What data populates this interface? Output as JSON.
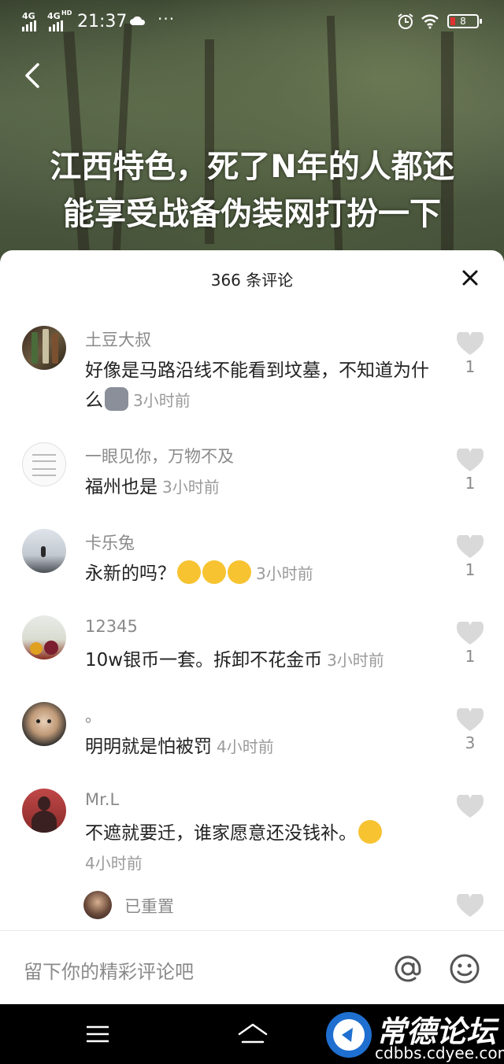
{
  "status_bar": {
    "network1": "4G",
    "network2": "4G",
    "network2_sup": "HD",
    "time": "21:37",
    "more": "···",
    "battery": "8"
  },
  "video": {
    "caption_line1": "江西特色，死了N年的人都还",
    "caption_line2": "能享受战备伪装网打扮一下"
  },
  "sheet": {
    "title": "366 条评论",
    "comments": [
      {
        "user": "土豆大叔",
        "text": "好像是马路沿线不能看到坟墓，不知道为什么",
        "time": "3小时前",
        "likes": "1"
      },
      {
        "user": "一眼见你，万物不及",
        "text": "福州也是",
        "time": "3小时前",
        "likes": "1"
      },
      {
        "user": "卡乐兔",
        "text": "永新的吗？",
        "time": "3小时前",
        "likes": "1"
      },
      {
        "user": "12345",
        "text": "10w银币一套。拆卸不花金币",
        "time": "3小时前",
        "likes": "1"
      },
      {
        "user": "。",
        "text": "明明就是怕被罚",
        "time": "4小时前",
        "likes": "3"
      },
      {
        "user": "Mr.L",
        "text": "不遮就要迁，谁家愿意还没钱补。",
        "time": "4小时前",
        "likes": ""
      },
      {
        "user": "已重置",
        "text": "",
        "time": "",
        "likes": ""
      }
    ]
  },
  "input": {
    "placeholder": "留下你的精彩评论吧"
  },
  "watermark": {
    "title": "常德论坛",
    "url": "cdbbs.cdyee.com"
  },
  "colors": {
    "sheet_bg": "#ffffff",
    "muted_text": "#8a8a8a",
    "heart": "#d9d9d9"
  }
}
